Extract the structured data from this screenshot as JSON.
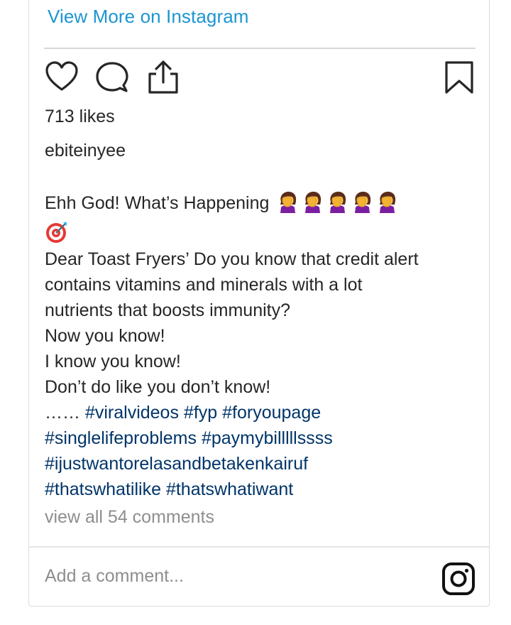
{
  "embed": {
    "view_more": "View More on Instagram",
    "likes": "713 likes",
    "author": "ebiteinyee",
    "caption": {
      "line1": "Ehh God! What’s Happening",
      "line3": "Dear Toast Fryers’ Do you know that credit alert",
      "line4": "contains vitamins and minerals with a lot",
      "line5": "nutrients that boosts immunity?",
      "line6": "Now you know!",
      "line7": "I know you know!",
      "line8": "Don’t do like you don’t know!",
      "line9_prefix": "…… ",
      "hashtags": [
        "#viralvideos",
        "#fyp",
        "#foryoupage",
        "#singlelifeproblems",
        "#paymybilllllssss",
        "#ijustwantorelasandbetakenkairuf",
        "#thatswhatilike",
        "#thatswhatiwant"
      ],
      "emoji": [
        "woman-facepalming-emoji",
        "direct-hit-emoji"
      ]
    },
    "comments_link": "view all 54 comments",
    "comment_placeholder": "Add a comment...",
    "icons": [
      "heart-icon",
      "comment-icon",
      "share-icon",
      "bookmark-icon",
      "instagram-logo-icon"
    ],
    "colors": {
      "link": "#1c95d2",
      "hashtag": "#003569",
      "muted": "#8e8e8e",
      "text": "#262626"
    }
  }
}
